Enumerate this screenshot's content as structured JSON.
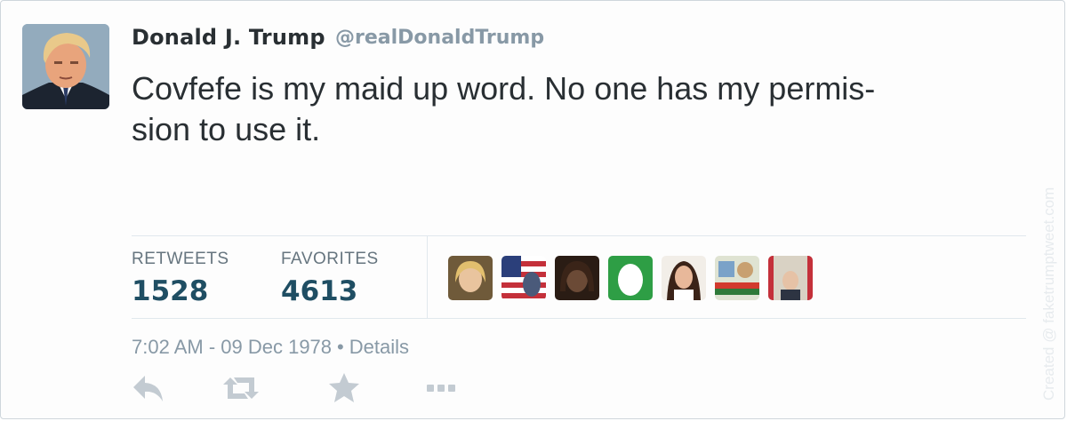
{
  "tweet": {
    "author_name": "Donald J. Trump",
    "handle": "@realDonaldTrump",
    "text_line1": "Covfefe is my maid up word. No one has my permis-",
    "text_line2": "sion to use it."
  },
  "stats": {
    "retweets_label": "RETWEETS",
    "retweets_value": "1528",
    "favorites_label": "FAVORITES",
    "favorites_value": "4613"
  },
  "favoriters": [
    {
      "name": "avatar-blonde-woman"
    },
    {
      "name": "avatar-flag"
    },
    {
      "name": "avatar-dark-hair"
    },
    {
      "name": "avatar-green-egg"
    },
    {
      "name": "avatar-brunette-woman"
    },
    {
      "name": "avatar-collage"
    },
    {
      "name": "avatar-older-man"
    }
  ],
  "timestamp": {
    "time_date": "7:02 AM - 09 Dec 1978",
    "separator": "•",
    "details_link": "Details"
  },
  "actions": [
    "reply-icon",
    "retweet-icon",
    "favorite-icon",
    "more-icon"
  ],
  "watermark": "Created @ faketrumptweet.com",
  "colors": {
    "text": "#292f33",
    "muted": "#8899a6",
    "stat_value": "#1f4e63",
    "border": "#e1e8ed"
  }
}
